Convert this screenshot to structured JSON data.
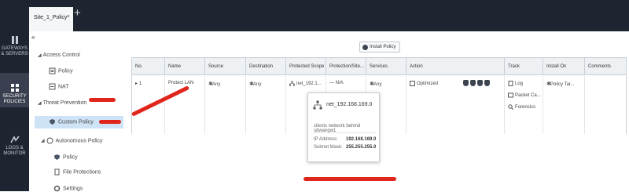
{
  "tabs": [
    {
      "label": "Site_1_Policy"
    }
  ],
  "tab_close": "×",
  "tab_add": "+",
  "rail": [
    {
      "label_1": "GATEWAYS",
      "label_2": "& SERVERS"
    },
    {
      "label_1": "SECURITY",
      "label_2": "POLICIES"
    },
    {
      "label_1": "LOGS &",
      "label_2": "MONITOR"
    }
  ],
  "collapse_label": "«",
  "tree": {
    "access_control": "Access Control",
    "policy": "Policy",
    "nat": "NAT",
    "threat_prevention": "Threat Prevention",
    "custom_policy": "Custom Policy",
    "autonomous_policy": "Autonomous Policy",
    "auto_policy": "Policy",
    "file_protections": "File Protections",
    "settings": "Settings"
  },
  "install_policy_label": "Install Policy",
  "columns": [
    "No.",
    "Name",
    "Source",
    "Destination",
    "Protected Scope",
    "Protection/Site...",
    "Services",
    "Action",
    "Track",
    "Install On",
    "Comments"
  ],
  "rule": {
    "no": "1",
    "name": "Protect LAN",
    "source": "Any",
    "destination": "Any",
    "protected_scope": "net_192.1...",
    "protection_site": "N/A",
    "services": "Any",
    "action": "Optimized",
    "track": [
      "Log",
      "Packet Ca...",
      "Forensics"
    ],
    "install_on": "Policy Tar..."
  },
  "tooltip": {
    "title": "net_192.168.169.0",
    "description": "clients network behind sdwangw1",
    "ip_label": "IP Address:",
    "ip_value": "192.168.169.0",
    "mask_label": "Subnet Mask:",
    "mask_value": "255.255.255.0"
  },
  "colors": {
    "rail_bg": "#1f2530",
    "selected": "#cfe3f6",
    "annotation": "#e0261c"
  }
}
